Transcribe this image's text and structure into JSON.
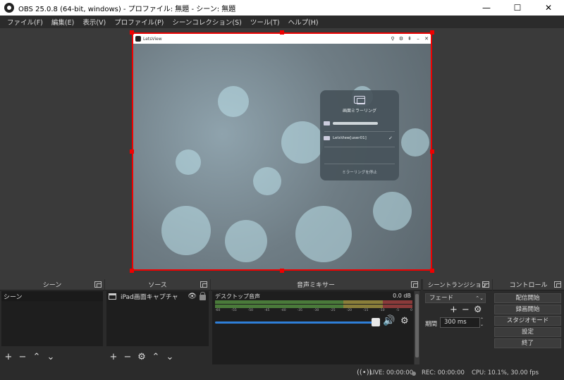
{
  "window": {
    "title": "OBS 25.0.8 (64-bit, windows) - プロファイル: 無題 - シーン: 無題"
  },
  "menu": [
    "ファイル(F)",
    "編集(E)",
    "表示(V)",
    "プロファイル(P)",
    "シーンコレクション(S)",
    "ツール(T)",
    "ヘルプ(H)"
  ],
  "preview": {
    "app_title": "LetsView",
    "panel_title": "画面ミラーリング",
    "device_name": "LetsView[user01]",
    "check": "✓",
    "stop_label": "ミラーリングを停止"
  },
  "docks": {
    "scenes": {
      "title": "シーン",
      "items": [
        "シーン"
      ]
    },
    "sources": {
      "title": "ソース",
      "items": [
        "iPad画面キャプチャ"
      ]
    },
    "mixer": {
      "title": "音声ミキサー",
      "track": "デスクトップ音声",
      "db": "0.0 dB",
      "scale": [
        "-60",
        "-55",
        "-50",
        "-45",
        "-40",
        "-35",
        "-30",
        "-25",
        "-20",
        "-15",
        "-10",
        "-5",
        "0"
      ],
      "volume": 1.0
    },
    "transitions": {
      "title": "シーントランジション",
      "selected": "フェード",
      "duration_label": "期間",
      "duration": "300 ms"
    },
    "controls": {
      "title": "コントロール",
      "buttons": [
        "配信開始",
        "録画開始",
        "スタジオモード",
        "設定",
        "終了"
      ]
    }
  },
  "status": {
    "live": "LIVE: 00:00:00",
    "rec": "REC: 00:00:00",
    "cpu": "CPU: 10.1%, 30.00 fps"
  }
}
